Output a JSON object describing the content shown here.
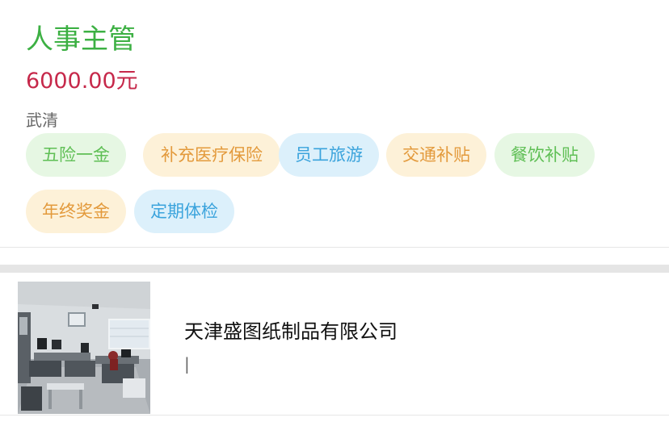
{
  "job": {
    "title": "人事主管",
    "salary": "6000.00元",
    "location": "武清",
    "benefit_tags": [
      {
        "label": "五险一金",
        "color": "green"
      },
      {
        "label": "补充医疗保险",
        "color": "orange"
      },
      {
        "label": "员工旅游",
        "color": "blue"
      },
      {
        "label": "交通补贴",
        "color": "orange"
      },
      {
        "label": "餐饮补贴",
        "color": "green"
      },
      {
        "label": "年终奖金",
        "color": "orange"
      },
      {
        "label": "定期体检",
        "color": "blue"
      }
    ]
  },
  "company": {
    "name": "天津盛图纸制品有限公司",
    "subtitle": "|"
  },
  "colors": {
    "title_green": "#3cb043",
    "salary_red": "#c6284a",
    "tag_green_bg": "#e6f7e3",
    "tag_orange_bg": "#fdf1d8",
    "tag_blue_bg": "#dcf0fb",
    "separator_gray": "#e5e5e5"
  }
}
